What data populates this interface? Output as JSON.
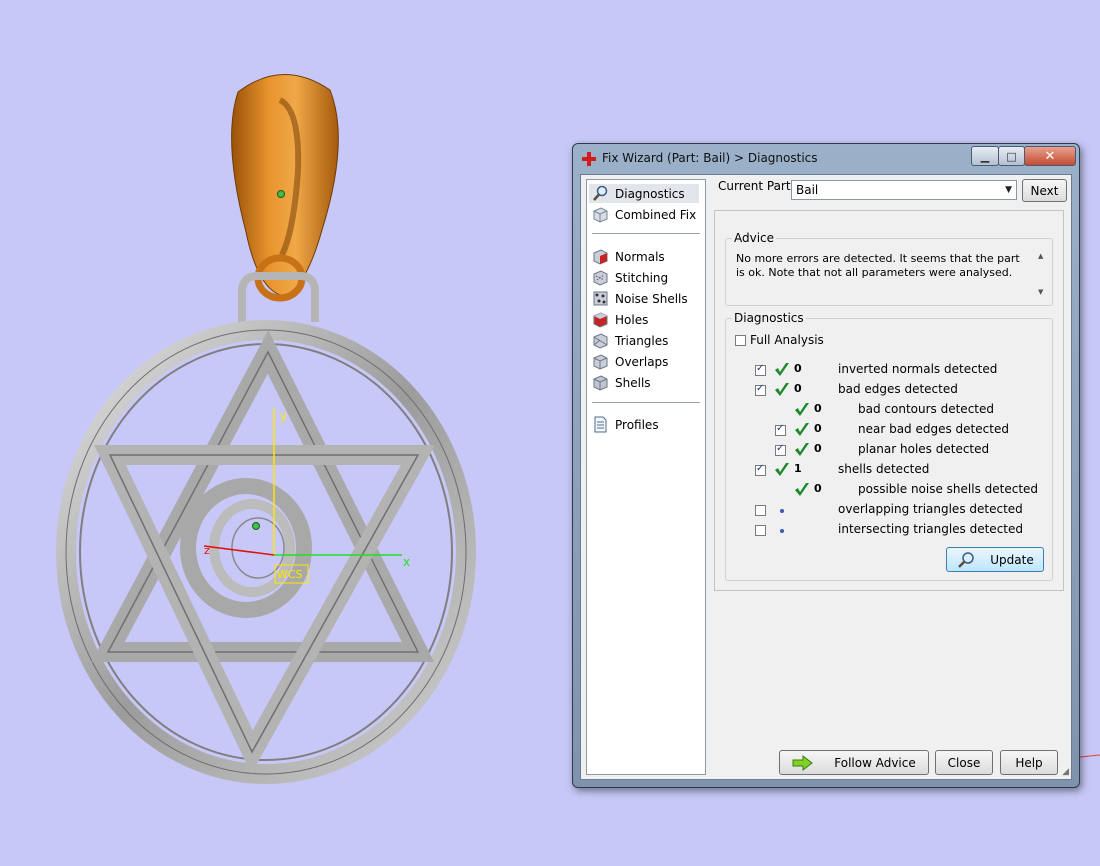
{
  "viewport": {
    "axis_labels": {
      "x": "x",
      "y": "y",
      "z": "z"
    },
    "wcs_label": "WCS",
    "colors": {
      "background": "#c8c8f8",
      "bail": "#d07a1c",
      "metal": "#a8a8a8"
    }
  },
  "dialog": {
    "title": "Fix Wizard (Part: Bail) > Diagnostics",
    "current_part_label": "Current Part:",
    "current_part_value": "Bail",
    "next_label": "Next",
    "nav": {
      "top_items": [
        {
          "label": "Diagnostics",
          "icon": "magnifier-icon",
          "selected": true
        },
        {
          "label": "Combined Fix",
          "icon": "cube-icon"
        }
      ],
      "fix_items": [
        {
          "label": "Normals",
          "icon": "normals-cube-icon"
        },
        {
          "label": "Stitching",
          "icon": "stitching-cube-icon"
        },
        {
          "label": "Noise Shells",
          "icon": "noise-shells-icon"
        },
        {
          "label": "Holes",
          "icon": "holes-cube-icon"
        },
        {
          "label": "Triangles",
          "icon": "triangles-cube-icon"
        },
        {
          "label": "Overlaps",
          "icon": "overlaps-cube-icon"
        },
        {
          "label": "Shells",
          "icon": "shells-cube-icon"
        }
      ],
      "bottom_items": [
        {
          "label": "Profiles",
          "icon": "document-icon"
        }
      ]
    },
    "advice": {
      "title": "Advice",
      "text": "No more errors are detected. It seems that the part is ok. Note that not all parameters were analysed."
    },
    "diagnostics": {
      "title": "Diagnostics",
      "full_analysis_label": "Full Analysis",
      "full_analysis_checked": false,
      "rows": [
        {
          "label": "inverted normals detected",
          "count": "0",
          "status": "ok",
          "checkbox": true,
          "checked": true,
          "indent": 0
        },
        {
          "label": "bad edges detected",
          "count": "0",
          "status": "ok",
          "checkbox": true,
          "checked": true,
          "indent": 0
        },
        {
          "label": "bad contours detected",
          "count": "0",
          "status": "ok",
          "checkbox": false,
          "checked": false,
          "indent": 1
        },
        {
          "label": "near bad edges detected",
          "count": "0",
          "status": "ok",
          "checkbox": true,
          "checked": true,
          "indent": 1
        },
        {
          "label": "planar holes detected",
          "count": "0",
          "status": "ok",
          "checkbox": true,
          "checked": true,
          "indent": 1
        },
        {
          "label": "shells detected",
          "count": "1",
          "status": "ok",
          "checkbox": true,
          "checked": true,
          "indent": 0
        },
        {
          "label": "possible noise shells detected",
          "count": "0",
          "status": "ok",
          "checkbox": false,
          "checked": false,
          "indent": 1
        },
        {
          "label": "overlapping triangles detected",
          "count": "",
          "status": "unchecked",
          "checkbox": true,
          "checked": false,
          "indent": 0
        },
        {
          "label": "intersecting triangles detected",
          "count": "",
          "status": "unchecked",
          "checkbox": true,
          "checked": false,
          "indent": 0
        }
      ],
      "update_label": "Update"
    },
    "footer": {
      "follow_advice_label": "Follow Advice",
      "close_label": "Close",
      "help_label": "Help"
    }
  }
}
